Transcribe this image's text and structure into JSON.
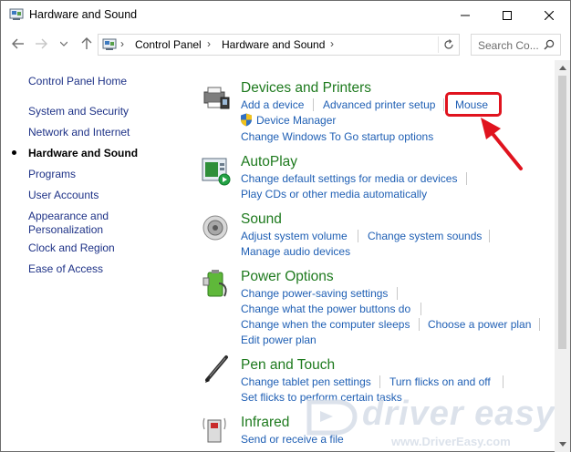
{
  "window": {
    "title": "Hardware and Sound",
    "icon": "control-panel-icon"
  },
  "address_bar": {
    "crumbs": [
      "Control Panel",
      "Hardware and Sound"
    ],
    "search_placeholder": "Search Co..."
  },
  "sidebar": {
    "items": [
      {
        "label": "Control Panel Home"
      },
      {
        "label": "System and Security"
      },
      {
        "label": "Network and Internet"
      },
      {
        "label": "Hardware and Sound",
        "current": true
      },
      {
        "label": "Programs"
      },
      {
        "label": "User Accounts"
      },
      {
        "label": "Appearance and Personalization"
      },
      {
        "label": "Clock and Region"
      },
      {
        "label": "Ease of Access"
      }
    ]
  },
  "categories": {
    "devices": {
      "title": "Devices and Printers",
      "links": [
        "Add a device",
        "Advanced printer setup",
        "Mouse",
        "Device Manager",
        "Change Windows To Go startup options"
      ]
    },
    "autoplay": {
      "title": "AutoPlay",
      "links": [
        "Change default settings for media or devices",
        "Play CDs or other media automatically"
      ]
    },
    "sound": {
      "title": "Sound",
      "links": [
        "Adjust system volume",
        "Change system sounds",
        "Manage audio devices"
      ]
    },
    "power": {
      "title": "Power Options",
      "links": [
        "Change power-saving settings",
        "Change what the power buttons do",
        "Change when the computer sleeps",
        "Choose a power plan",
        "Edit power plan"
      ]
    },
    "pen": {
      "title": "Pen and Touch",
      "links": [
        "Change tablet pen settings",
        "Turn flicks on and off",
        "Set flicks to perform certain tasks"
      ]
    },
    "infrared": {
      "title": "Infrared",
      "links": [
        "Send or receive a file"
      ]
    }
  },
  "watermark": {
    "brand": "driver easy",
    "url": "www.DriverEasy.com"
  },
  "colors": {
    "link": "#1f5fb4",
    "category_title": "#1e7a1e",
    "highlight": "#e0131e"
  }
}
